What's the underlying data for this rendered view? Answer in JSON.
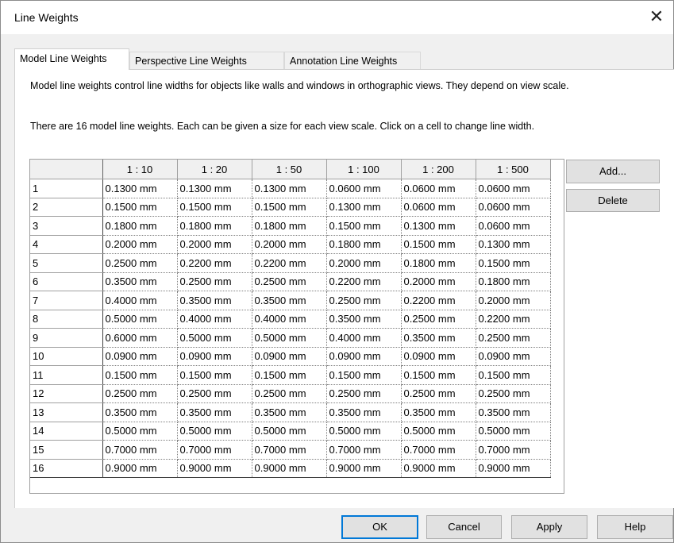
{
  "dialog": {
    "title": "Line Weights",
    "close_icon": "close-icon",
    "close_glyph": "✕"
  },
  "tabs": [
    {
      "label": "Model Line Weights",
      "active": true
    },
    {
      "label": "Perspective Line Weights",
      "active": false
    },
    {
      "label": "Annotation Line Weights",
      "active": false
    }
  ],
  "panel": {
    "description_1": "Model line weights control line widths for objects like walls and windows in orthographic views. They depend on view scale.",
    "description_2": "There are 16 model line weights. Each can be given a size for each view scale. Click on a cell to change line width."
  },
  "grid": {
    "columns": [
      "1 : 10",
      "1 : 20",
      "1 : 50",
      "1 : 100",
      "1 : 200",
      "1 : 500"
    ],
    "rows": [
      {
        "label": "1",
        "values": [
          "0.1300 mm",
          "0.1300 mm",
          "0.1300 mm",
          "0.0600 mm",
          "0.0600 mm",
          "0.0600 mm"
        ]
      },
      {
        "label": "2",
        "values": [
          "0.1500 mm",
          "0.1500 mm",
          "0.1500 mm",
          "0.1300 mm",
          "0.0600 mm",
          "0.0600 mm"
        ]
      },
      {
        "label": "3",
        "values": [
          "0.1800 mm",
          "0.1800 mm",
          "0.1800 mm",
          "0.1500 mm",
          "0.1300 mm",
          "0.0600 mm"
        ]
      },
      {
        "label": "4",
        "values": [
          "0.2000 mm",
          "0.2000 mm",
          "0.2000 mm",
          "0.1800 mm",
          "0.1500 mm",
          "0.1300 mm"
        ]
      },
      {
        "label": "5",
        "values": [
          "0.2500 mm",
          "0.2200 mm",
          "0.2200 mm",
          "0.2000 mm",
          "0.1800 mm",
          "0.1500 mm"
        ]
      },
      {
        "label": "6",
        "values": [
          "0.3500 mm",
          "0.2500 mm",
          "0.2500 mm",
          "0.2200 mm",
          "0.2000 mm",
          "0.1800 mm"
        ]
      },
      {
        "label": "7",
        "values": [
          "0.4000 mm",
          "0.3500 mm",
          "0.3500 mm",
          "0.2500 mm",
          "0.2200 mm",
          "0.2000 mm"
        ]
      },
      {
        "label": "8",
        "values": [
          "0.5000 mm",
          "0.4000 mm",
          "0.4000 mm",
          "0.3500 mm",
          "0.2500 mm",
          "0.2200 mm"
        ]
      },
      {
        "label": "9",
        "values": [
          "0.6000 mm",
          "0.5000 mm",
          "0.5000 mm",
          "0.4000 mm",
          "0.3500 mm",
          "0.2500 mm"
        ]
      },
      {
        "label": "10",
        "values": [
          "0.0900 mm",
          "0.0900 mm",
          "0.0900 mm",
          "0.0900 mm",
          "0.0900 mm",
          "0.0900 mm"
        ]
      },
      {
        "label": "11",
        "values": [
          "0.1500 mm",
          "0.1500 mm",
          "0.1500 mm",
          "0.1500 mm",
          "0.1500 mm",
          "0.1500 mm"
        ]
      },
      {
        "label": "12",
        "values": [
          "0.2500 mm",
          "0.2500 mm",
          "0.2500 mm",
          "0.2500 mm",
          "0.2500 mm",
          "0.2500 mm"
        ]
      },
      {
        "label": "13",
        "values": [
          "0.3500 mm",
          "0.3500 mm",
          "0.3500 mm",
          "0.3500 mm",
          "0.3500 mm",
          "0.3500 mm"
        ]
      },
      {
        "label": "14",
        "values": [
          "0.5000 mm",
          "0.5000 mm",
          "0.5000 mm",
          "0.5000 mm",
          "0.5000 mm",
          "0.5000 mm"
        ]
      },
      {
        "label": "15",
        "values": [
          "0.7000 mm",
          "0.7000 mm",
          "0.7000 mm",
          "0.7000 mm",
          "0.7000 mm",
          "0.7000 mm"
        ]
      },
      {
        "label": "16",
        "values": [
          "0.9000 mm",
          "0.9000 mm",
          "0.9000 mm",
          "0.9000 mm",
          "0.9000 mm",
          "0.9000 mm"
        ]
      }
    ]
  },
  "side_buttons": {
    "add_label": "Add...",
    "delete_label": "Delete"
  },
  "footer": {
    "ok_label": "OK",
    "cancel_label": "Cancel",
    "apply_label": "Apply",
    "help_label": "Help"
  },
  "colors": {
    "accent": "#0078d7",
    "dialog_bg": "#f0f0f0",
    "panel_bg": "#ffffff"
  }
}
